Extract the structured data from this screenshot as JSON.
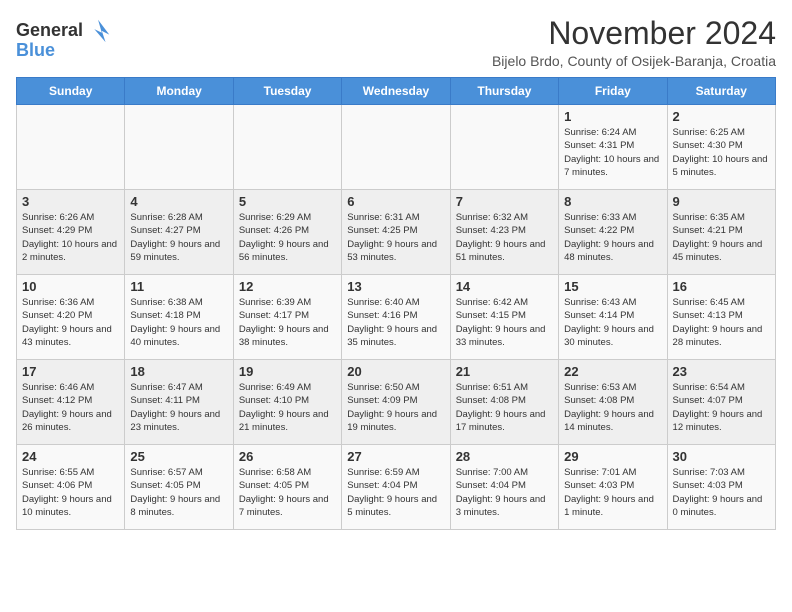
{
  "logo": {
    "general": "General",
    "blue": "Blue"
  },
  "title": "November 2024",
  "subtitle": "Bijelo Brdo, County of Osijek-Baranja, Croatia",
  "weekdays": [
    "Sunday",
    "Monday",
    "Tuesday",
    "Wednesday",
    "Thursday",
    "Friday",
    "Saturday"
  ],
  "weeks": [
    [
      {
        "day": "",
        "info": ""
      },
      {
        "day": "",
        "info": ""
      },
      {
        "day": "",
        "info": ""
      },
      {
        "day": "",
        "info": ""
      },
      {
        "day": "",
        "info": ""
      },
      {
        "day": "1",
        "info": "Sunrise: 6:24 AM\nSunset: 4:31 PM\nDaylight: 10 hours and 7 minutes."
      },
      {
        "day": "2",
        "info": "Sunrise: 6:25 AM\nSunset: 4:30 PM\nDaylight: 10 hours and 5 minutes."
      }
    ],
    [
      {
        "day": "3",
        "info": "Sunrise: 6:26 AM\nSunset: 4:29 PM\nDaylight: 10 hours and 2 minutes."
      },
      {
        "day": "4",
        "info": "Sunrise: 6:28 AM\nSunset: 4:27 PM\nDaylight: 9 hours and 59 minutes."
      },
      {
        "day": "5",
        "info": "Sunrise: 6:29 AM\nSunset: 4:26 PM\nDaylight: 9 hours and 56 minutes."
      },
      {
        "day": "6",
        "info": "Sunrise: 6:31 AM\nSunset: 4:25 PM\nDaylight: 9 hours and 53 minutes."
      },
      {
        "day": "7",
        "info": "Sunrise: 6:32 AM\nSunset: 4:23 PM\nDaylight: 9 hours and 51 minutes."
      },
      {
        "day": "8",
        "info": "Sunrise: 6:33 AM\nSunset: 4:22 PM\nDaylight: 9 hours and 48 minutes."
      },
      {
        "day": "9",
        "info": "Sunrise: 6:35 AM\nSunset: 4:21 PM\nDaylight: 9 hours and 45 minutes."
      }
    ],
    [
      {
        "day": "10",
        "info": "Sunrise: 6:36 AM\nSunset: 4:20 PM\nDaylight: 9 hours and 43 minutes."
      },
      {
        "day": "11",
        "info": "Sunrise: 6:38 AM\nSunset: 4:18 PM\nDaylight: 9 hours and 40 minutes."
      },
      {
        "day": "12",
        "info": "Sunrise: 6:39 AM\nSunset: 4:17 PM\nDaylight: 9 hours and 38 minutes."
      },
      {
        "day": "13",
        "info": "Sunrise: 6:40 AM\nSunset: 4:16 PM\nDaylight: 9 hours and 35 minutes."
      },
      {
        "day": "14",
        "info": "Sunrise: 6:42 AM\nSunset: 4:15 PM\nDaylight: 9 hours and 33 minutes."
      },
      {
        "day": "15",
        "info": "Sunrise: 6:43 AM\nSunset: 4:14 PM\nDaylight: 9 hours and 30 minutes."
      },
      {
        "day": "16",
        "info": "Sunrise: 6:45 AM\nSunset: 4:13 PM\nDaylight: 9 hours and 28 minutes."
      }
    ],
    [
      {
        "day": "17",
        "info": "Sunrise: 6:46 AM\nSunset: 4:12 PM\nDaylight: 9 hours and 26 minutes."
      },
      {
        "day": "18",
        "info": "Sunrise: 6:47 AM\nSunset: 4:11 PM\nDaylight: 9 hours and 23 minutes."
      },
      {
        "day": "19",
        "info": "Sunrise: 6:49 AM\nSunset: 4:10 PM\nDaylight: 9 hours and 21 minutes."
      },
      {
        "day": "20",
        "info": "Sunrise: 6:50 AM\nSunset: 4:09 PM\nDaylight: 9 hours and 19 minutes."
      },
      {
        "day": "21",
        "info": "Sunrise: 6:51 AM\nSunset: 4:08 PM\nDaylight: 9 hours and 17 minutes."
      },
      {
        "day": "22",
        "info": "Sunrise: 6:53 AM\nSunset: 4:08 PM\nDaylight: 9 hours and 14 minutes."
      },
      {
        "day": "23",
        "info": "Sunrise: 6:54 AM\nSunset: 4:07 PM\nDaylight: 9 hours and 12 minutes."
      }
    ],
    [
      {
        "day": "24",
        "info": "Sunrise: 6:55 AM\nSunset: 4:06 PM\nDaylight: 9 hours and 10 minutes."
      },
      {
        "day": "25",
        "info": "Sunrise: 6:57 AM\nSunset: 4:05 PM\nDaylight: 9 hours and 8 minutes."
      },
      {
        "day": "26",
        "info": "Sunrise: 6:58 AM\nSunset: 4:05 PM\nDaylight: 9 hours and 7 minutes."
      },
      {
        "day": "27",
        "info": "Sunrise: 6:59 AM\nSunset: 4:04 PM\nDaylight: 9 hours and 5 minutes."
      },
      {
        "day": "28",
        "info": "Sunrise: 7:00 AM\nSunset: 4:04 PM\nDaylight: 9 hours and 3 minutes."
      },
      {
        "day": "29",
        "info": "Sunrise: 7:01 AM\nSunset: 4:03 PM\nDaylight: 9 hours and 1 minute."
      },
      {
        "day": "30",
        "info": "Sunrise: 7:03 AM\nSunset: 4:03 PM\nDaylight: 9 hours and 0 minutes."
      }
    ]
  ]
}
